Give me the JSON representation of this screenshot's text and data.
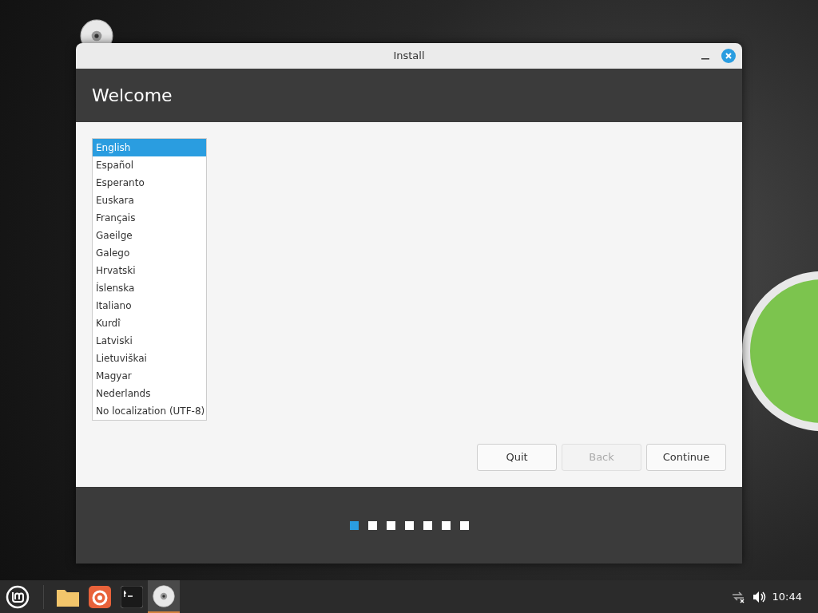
{
  "window": {
    "title": "Install"
  },
  "header": {
    "title": "Welcome"
  },
  "languages": [
    {
      "label": "English",
      "selected": true
    },
    {
      "label": "Español",
      "selected": false
    },
    {
      "label": "Esperanto",
      "selected": false
    },
    {
      "label": "Euskara",
      "selected": false
    },
    {
      "label": "Français",
      "selected": false
    },
    {
      "label": "Gaeilge",
      "selected": false
    },
    {
      "label": "Galego",
      "selected": false
    },
    {
      "label": "Hrvatski",
      "selected": false
    },
    {
      "label": "Íslenska",
      "selected": false
    },
    {
      "label": "Italiano",
      "selected": false
    },
    {
      "label": "Kurdî",
      "selected": false
    },
    {
      "label": "Latviski",
      "selected": false
    },
    {
      "label": "Lietuviškai",
      "selected": false
    },
    {
      "label": "Magyar",
      "selected": false
    },
    {
      "label": "Nederlands",
      "selected": false
    },
    {
      "label": "No localization (UTF-8)",
      "selected": false
    }
  ],
  "buttons": [
    {
      "label": "Quit",
      "disabled": false
    },
    {
      "label": "Back",
      "disabled": true
    },
    {
      "label": "Continue",
      "disabled": false
    }
  ],
  "progress": [
    {
      "selected": true
    },
    {
      "selected": false
    },
    {
      "selected": false
    },
    {
      "selected": false
    },
    {
      "selected": false
    },
    {
      "selected": false
    },
    {
      "selected": false
    }
  ],
  "taskbar": {
    "launchers": [
      {
        "kind": "files",
        "selected": false
      },
      {
        "kind": "browser",
        "selected": false
      },
      {
        "kind": "terminal",
        "selected": false
      },
      {
        "kind": "disc",
        "selected": true
      }
    ],
    "clock": "10:44"
  }
}
